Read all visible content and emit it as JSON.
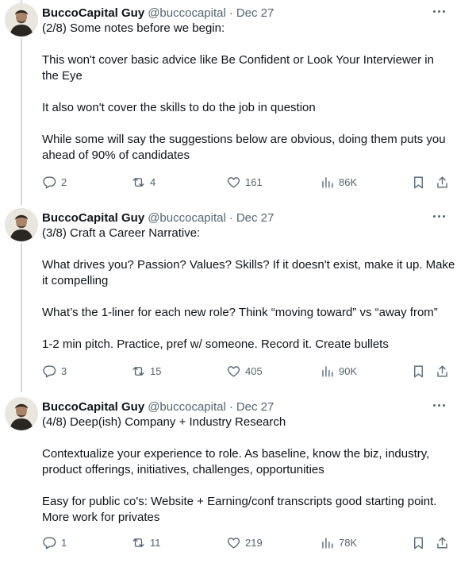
{
  "tweets": [
    {
      "name": "BuccoCapital Guy",
      "handle": "@buccocapital",
      "sep": "·",
      "date": "Dec 27",
      "lines": [
        "(2/8) Some notes before we begin:",
        "",
        "This won't cover basic advice like Be Confident or Look Your Interviewer in",
        "the Eye",
        "",
        "It also won't cover the skills to do the job in question",
        "",
        "While some will say the suggestions below are obvious, doing them puts you",
        "ahead of 90% of candidates"
      ],
      "replies": "2",
      "retweets": "4",
      "likes": "161",
      "views": "86K"
    },
    {
      "name": "BuccoCapital Guy",
      "handle": "@buccocapital",
      "sep": "·",
      "date": "Dec 27",
      "lines": [
        "(3/8) Craft a Career Narrative:",
        "",
        "What drives you? Passion? Values? Skills? If it doesn't exist, make it up. Make",
        "it compelling",
        "",
        "What’s the 1-liner for each new role? Think “moving toward” vs “away from”",
        "",
        "1-2 min pitch. Practice, pref w/ someone. Record it. Create bullets"
      ],
      "replies": "3",
      "retweets": "15",
      "likes": "405",
      "views": "90K"
    },
    {
      "name": "BuccoCapital Guy",
      "handle": "@buccocapital",
      "sep": "·",
      "date": "Dec 27",
      "lines": [
        "(4/8) Deep(ish) Company + Industry Research",
        "",
        "Contextualize your experience to role. As baseline, know the biz, industry,",
        "product offerings, initiatives, challenges, opportunities",
        "",
        "Easy for public co's: Website + Earning/conf transcripts good starting point.",
        "More work for privates"
      ],
      "replies": "1",
      "retweets": "11",
      "likes": "219",
      "views": "78K"
    }
  ],
  "icons": {
    "reply": "reply-icon",
    "retweet": "retweet-icon",
    "like": "heart-icon",
    "views": "views-icon",
    "bookmark": "bookmark-icon",
    "share": "share-icon",
    "more": "more-icon"
  }
}
